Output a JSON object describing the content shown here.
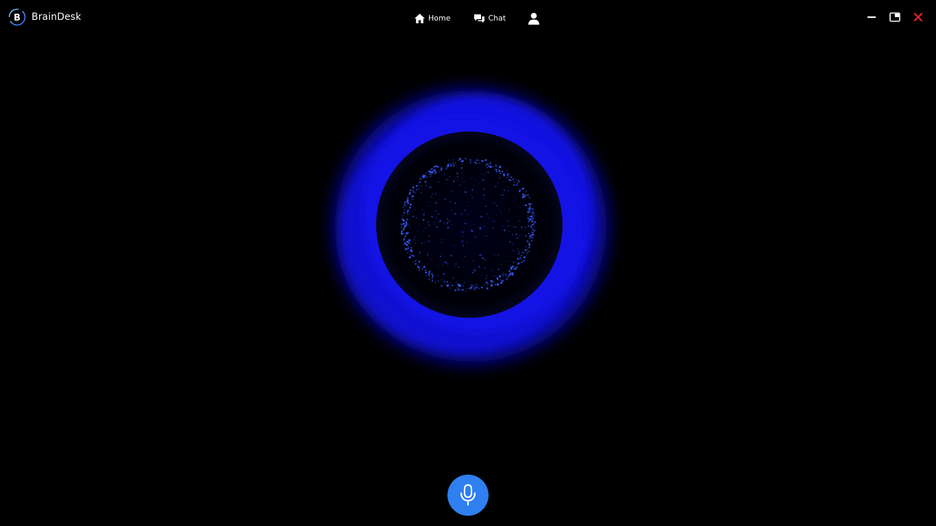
{
  "app": {
    "title": "BrainDesk"
  },
  "nav": {
    "home_label": "Home",
    "chat_label": "Chat",
    "home_icon": "home-icon",
    "chat_icon": "chat-bubbles-icon",
    "profile_icon": "user-icon"
  },
  "window_controls": {
    "minimize_icon": "minimize-icon",
    "restore_icon": "restore-icon",
    "close_icon": "close-icon",
    "close_color": "#e0202a"
  },
  "assistant": {
    "orb_icon": "voice-orb-visualizer",
    "ring_color": "#1a1aff",
    "particle_color": "#3a5cff"
  },
  "mic": {
    "icon": "microphone-icon",
    "background_color": "#2f7ff0"
  }
}
